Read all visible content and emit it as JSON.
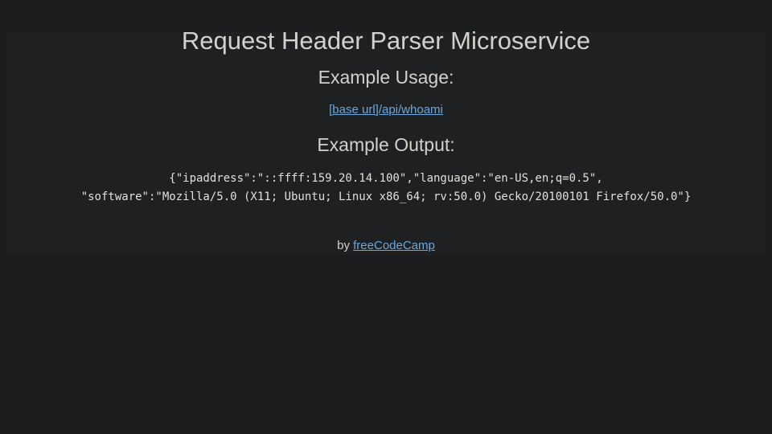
{
  "page": {
    "title": "Request Header Parser Microservice"
  },
  "usage": {
    "heading": "Example Usage:",
    "link_text": "[base url]/api/whoami"
  },
  "output": {
    "heading": "Example Output:",
    "lines": [
      "{\"ipaddress\":\"::ffff:159.20.14.100\",\"language\":\"en-US,en;q=0.5\",",
      "\"software\":\"Mozilla/5.0 (X11; Ubuntu; Linux x86_64; rv:50.0) Gecko/20100101 Firefox/50.0\"}"
    ]
  },
  "footer": {
    "prefix": "by",
    "link_text": "freeCodeCamp"
  },
  "colors": {
    "background": "#1b1c1e",
    "panel": "#1f2022",
    "text": "#d4d1cc",
    "link": "#6aa8dd"
  }
}
